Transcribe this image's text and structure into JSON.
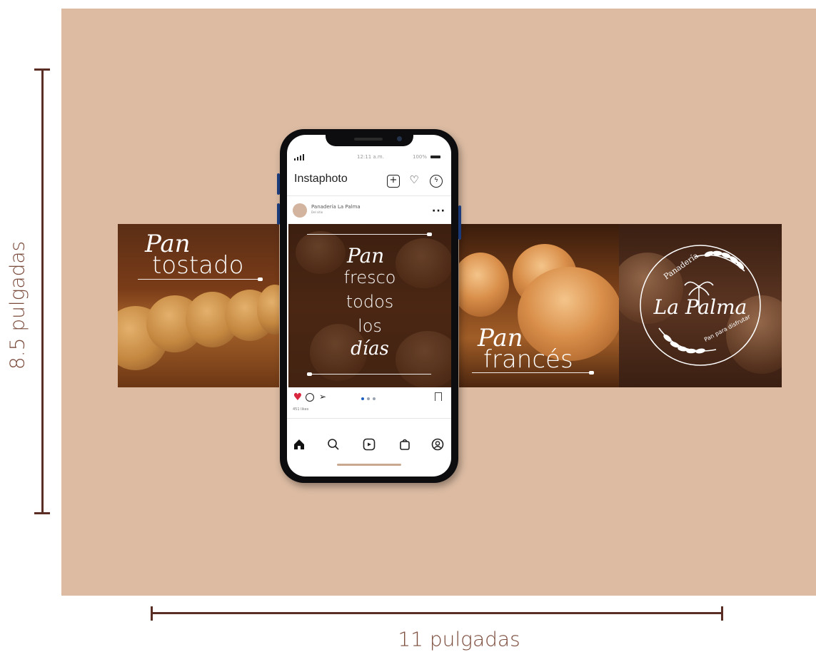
{
  "dimensions": {
    "height_label": "8.5 pulgadas",
    "width_label": "11 pulgadas"
  },
  "panels": [
    {
      "script_word": "Pan",
      "main_word": "tostado"
    },
    {
      "script_word": "Pan",
      "lines": [
        "fresco",
        "todos",
        "los"
      ],
      "script_end": "días"
    },
    {
      "script_word": "Pan",
      "main_word": "francés"
    },
    {
      "logo_top": "Panadería",
      "logo_name": "La Palma",
      "logo_tagline": "Pan para disfrutar"
    }
  ],
  "phone": {
    "status_time": "12:11 a.m.",
    "status_battery": "100%",
    "app_title": "Instaphoto",
    "account_name": "Panadería La Palma",
    "account_sub": "Del sitio",
    "likes_text": "451 likes",
    "icons": {
      "header": [
        "new-post-icon",
        "heart-icon",
        "messenger-icon"
      ],
      "actions": [
        "like-icon",
        "comment-icon",
        "share-icon",
        "bookmark-icon"
      ],
      "nav": [
        "home-icon",
        "search-icon",
        "reels-icon",
        "shop-icon",
        "profile-icon"
      ]
    }
  },
  "colors": {
    "canvas": "#dcbba2",
    "ruler": "#5a2e25",
    "label": "#7a4a3a",
    "like_red": "#d7263d",
    "carousel_active": "#1f5fbf"
  }
}
